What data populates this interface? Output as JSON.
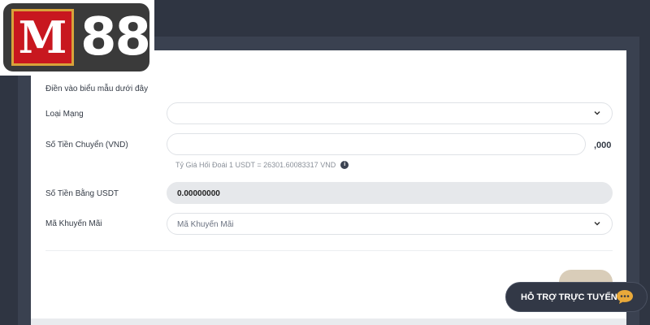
{
  "brand": {
    "logo_text": "M88"
  },
  "form": {
    "intro": "Điền vào biểu mẫu dưới đây",
    "network": {
      "label": "Loại Mạng",
      "value": ""
    },
    "amount": {
      "label": "Số Tiền Chuyển (VND)",
      "value": "",
      "suffix": ",000"
    },
    "rate_note": "Tỷ Giá Hối Đoái 1 USDT = 26301.60083317 VND",
    "usdt": {
      "label": "Số Tiền Bằng USDT",
      "value": "0.00000000"
    },
    "promo": {
      "label": "Mã Khuyến Mãi",
      "placeholder": "Mã Khuyến Mãi"
    }
  },
  "support": {
    "label": "HỖ TRỢ TRỰC TUYẾN"
  },
  "colors": {
    "accent": "#d9cdb9",
    "dark": "#2f3542",
    "brand_red": "#c8171f"
  }
}
